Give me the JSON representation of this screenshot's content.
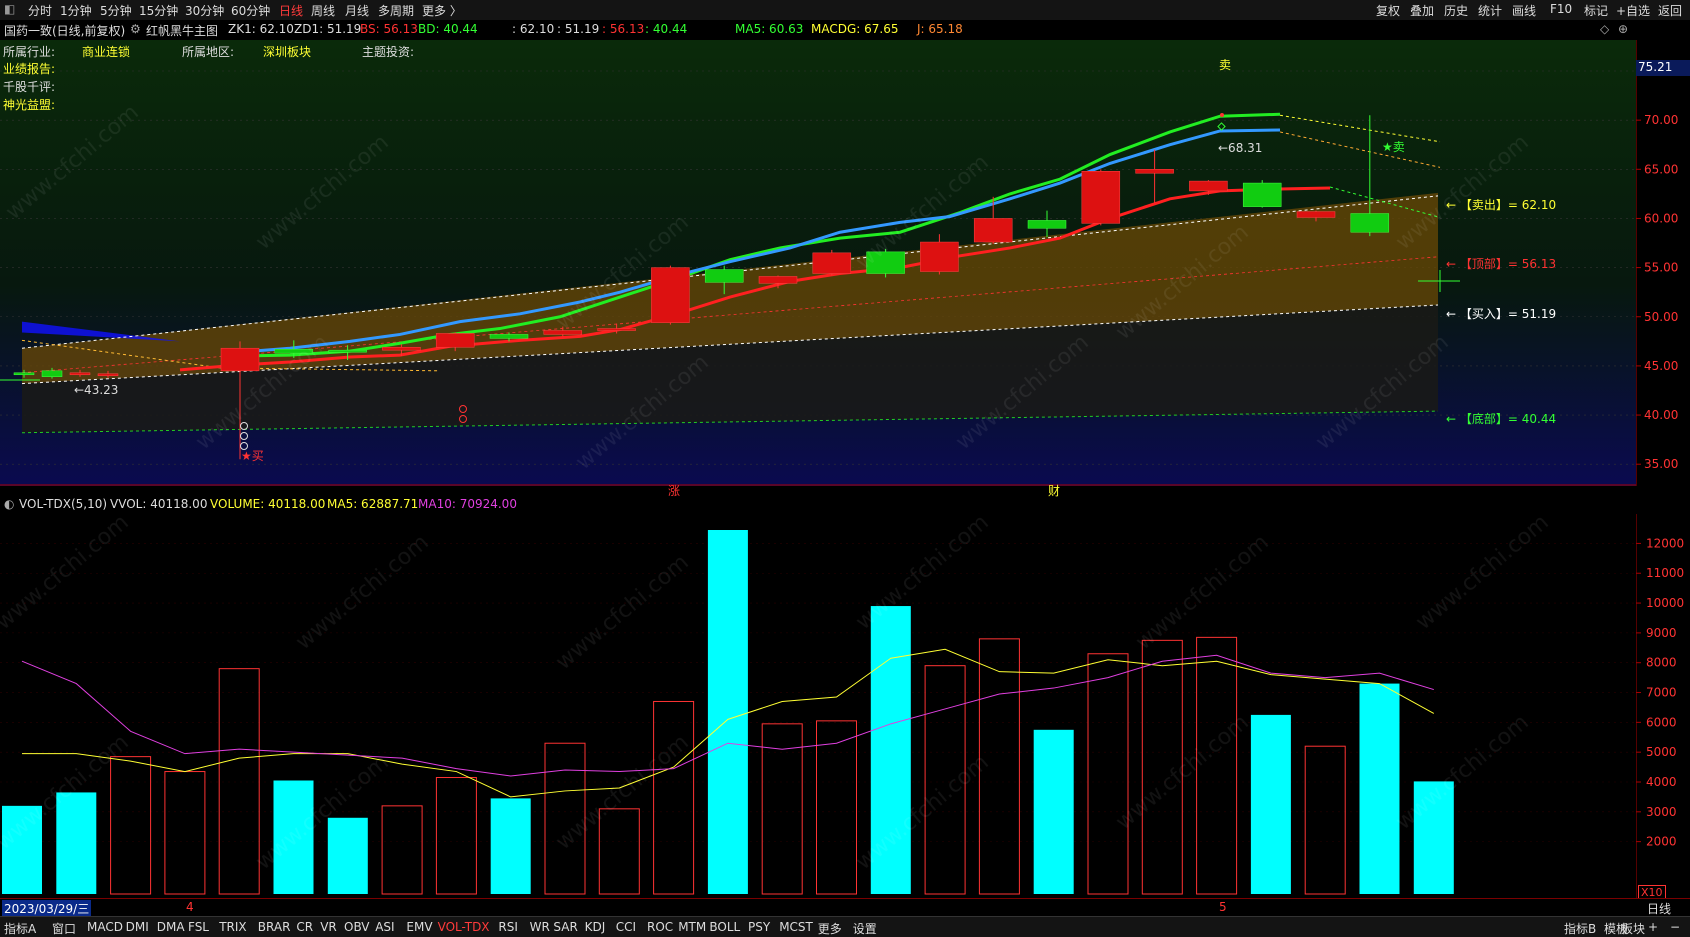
{
  "top_menu": {
    "left": [
      "分时",
      "1分钟",
      "5分钟",
      "15分钟",
      "30分钟",
      "60分钟",
      "日线",
      "周线",
      "月线",
      "多周期",
      "更多 〉"
    ],
    "active": "日线",
    "right": [
      "复权",
      "叠加",
      "历史",
      "统计",
      "画线",
      "F10",
      "标记",
      "+自选",
      "返回"
    ]
  },
  "info": {
    "stock": "国药一致(日线,前复权)",
    "indicator": "红帆黑牛主图",
    "zk1": "ZK1: 62.10",
    "zd1": "ZD1: 51.19",
    "bs": "BS: 56.13",
    "bd": "BD: 40.44",
    "vals": ": 62.10",
    "vals2": ": 51.19",
    "vals3": ": 56.13",
    "vals4": ": 40.44",
    "ma5": "MA5: 60.63",
    "macdg": "MACDG: 67.65",
    "j": "J: 65.18"
  },
  "side_labels": {
    "industry_label": "所属行业:",
    "industry_value": "商业连锁",
    "region_label": "所属地区:",
    "region_value": "深圳板块",
    "theme_label": "主题投资:",
    "report": "业绩报告:",
    "review": "千股千评:",
    "divine": "神光益盟:"
  },
  "price_axis": {
    "current": "75.21",
    "ticks": [
      "75.00",
      "70.00",
      "65.00",
      "60.00",
      "55.00",
      "50.00",
      "45.00",
      "40.00",
      "35.00"
    ]
  },
  "annotations": {
    "sell_out": "← 【卖出】= 62.10",
    "top": "← 【顶部】= 56.13",
    "buy_in": "← 【买入】= 51.19",
    "bottom": "← 【底部】= 40.44",
    "low_mark": "←43.23",
    "high_mark": "←68.31",
    "buy_signal": "★买",
    "sell_signal_top": "卖",
    "sell_signal_right": "★卖",
    "zhang": "涨",
    "cai": "财"
  },
  "volume_header": {
    "name": "VOL-TDX(5,10)",
    "vvol": "VVOL: 40118.00",
    "volume": "VOLUME: 40118.00",
    "ma5": "MA5: 62887.71",
    "ma10": "MA10: 70924.00"
  },
  "volume_axis": {
    "ticks": [
      "12000",
      "11000",
      "10000",
      "9000",
      "8000",
      "7000",
      "6000",
      "5000",
      "4000",
      "3000",
      "2000"
    ],
    "unit": "X10"
  },
  "date_bar": {
    "date": "2023/03/29/三",
    "m4": "4",
    "m5": "5",
    "period": "日线"
  },
  "bottom_tabs": [
    "指标A",
    "窗口",
    "MACD",
    "DMI",
    "DMA",
    "FSL",
    "TRIX",
    "BRAR",
    "CR",
    "VR",
    "OBV",
    "ASI",
    "EMV",
    "VOL-TDX",
    "RSI",
    "WR",
    "SAR",
    "KDJ",
    "CCI",
    "ROC",
    "MTM",
    "BOLL",
    "PSY",
    "MCST",
    "更多",
    "设置"
  ],
  "bottom_active": "VOL-TDX",
  "bottom_right": [
    "指标B",
    "模板",
    "板块",
    "+",
    "−"
  ],
  "watermark": "www.cfchi.com",
  "colors": {
    "up": "#ff2020",
    "down": "#00e5ff",
    "green": "#22ee22",
    "blue": "#3399ff",
    "yellow": "#ffff33",
    "magenta": "#e040e0"
  },
  "chart_data": {
    "type": "candlestick",
    "price_ylim": [
      35,
      75
    ],
    "candles": [
      {
        "o": 44.2,
        "h": 44.6,
        "l": 43.8,
        "c": 44.3,
        "up": false
      },
      {
        "o": 44.5,
        "h": 44.8,
        "l": 43.7,
        "c": 43.9,
        "up": false
      },
      {
        "o": 44.3,
        "h": 44.6,
        "l": 43.9,
        "c": 44.1,
        "up": true
      },
      {
        "o": 44.2,
        "h": 44.5,
        "l": 43.8,
        "c": 44.0,
        "up": true
      },
      {
        "o": 44.5,
        "h": 47.5,
        "l": 35.5,
        "c": 46.8,
        "up": true
      },
      {
        "o": 46.3,
        "h": 47.6,
        "l": 45.8,
        "c": 46.7,
        "up": false
      },
      {
        "o": 46.4,
        "h": 47.1,
        "l": 45.6,
        "c": 46.6,
        "up": false
      },
      {
        "o": 46.6,
        "h": 47.2,
        "l": 46.0,
        "c": 46.9,
        "up": true
      },
      {
        "o": 46.9,
        "h": 48.4,
        "l": 46.5,
        "c": 48.3,
        "up": true
      },
      {
        "o": 47.8,
        "h": 48.4,
        "l": 47.5,
        "c": 48.2,
        "up": false
      },
      {
        "o": 48.2,
        "h": 49.0,
        "l": 48.0,
        "c": 48.6,
        "up": true
      },
      {
        "o": 48.6,
        "h": 49.3,
        "l": 48.3,
        "c": 48.8,
        "up": true
      },
      {
        "o": 49.4,
        "h": 55.2,
        "l": 49.2,
        "c": 55.0,
        "up": true
      },
      {
        "o": 54.8,
        "h": 55.2,
        "l": 52.3,
        "c": 53.5,
        "up": false
      },
      {
        "o": 53.4,
        "h": 54.2,
        "l": 52.9,
        "c": 54.1,
        "up": true
      },
      {
        "o": 54.4,
        "h": 56.8,
        "l": 54.2,
        "c": 56.5,
        "up": true
      },
      {
        "o": 56.6,
        "h": 56.9,
        "l": 54.0,
        "c": 54.4,
        "up": false
      },
      {
        "o": 54.6,
        "h": 58.4,
        "l": 54.3,
        "c": 57.6,
        "up": true
      },
      {
        "o": 57.6,
        "h": 62.2,
        "l": 57.4,
        "c": 60.0,
        "up": true
      },
      {
        "o": 59.8,
        "h": 60.8,
        "l": 58.1,
        "c": 59.0,
        "up": false
      },
      {
        "o": 59.5,
        "h": 65.0,
        "l": 59.3,
        "c": 64.8,
        "up": true
      },
      {
        "o": 64.6,
        "h": 67.0,
        "l": 61.6,
        "c": 65.0,
        "up": true
      },
      {
        "o": 62.8,
        "h": 63.9,
        "l": 62.4,
        "c": 63.8,
        "up": true
      },
      {
        "o": 61.2,
        "h": 63.9,
        "l": 61.1,
        "c": 63.6,
        "up": false
      },
      {
        "o": 60.1,
        "h": 60.8,
        "l": 59.7,
        "c": 60.7,
        "up": true
      },
      {
        "o": 60.5,
        "h": 70.5,
        "l": 58.2,
        "c": 58.6,
        "up": false
      }
    ],
    "volume_ylim": [
      1000,
      12600
    ],
    "volume": [
      3200,
      3650,
      4850,
      4350,
      7800,
      4050,
      2800,
      3200,
      4150,
      3450,
      5300,
      3100,
      6700,
      12450,
      5950,
      6050,
      9900,
      7900,
      8800,
      5750,
      8300,
      8750,
      8850,
      6250,
      5200,
      7300,
      4020
    ],
    "volume_up": [
      false,
      false,
      true,
      true,
      true,
      false,
      false,
      true,
      true,
      false,
      true,
      true,
      true,
      false,
      true,
      true,
      false,
      true,
      true,
      false,
      true,
      true,
      true,
      false,
      true,
      false,
      false
    ],
    "vol_ma5": [
      4950,
      4950,
      4700,
      4350,
      4800,
      4950,
      4950,
      4600,
      4350,
      3500,
      3700,
      3800,
      4500,
      6100,
      6700,
      6850,
      8150,
      8450,
      7700,
      7650,
      8100,
      7900,
      8050,
      7600,
      7450,
      7300,
      6300
    ],
    "vol_ma10": [
      8050,
      7300,
      5700,
      4950,
      5100,
      5000,
      4900,
      4800,
      4450,
      4200,
      4400,
      4350,
      4450,
      5300,
      5100,
      5300,
      5950,
      6450,
      6950,
      7150,
      7500,
      8050,
      8250,
      7650,
      7500,
      7650,
      7100
    ]
  }
}
